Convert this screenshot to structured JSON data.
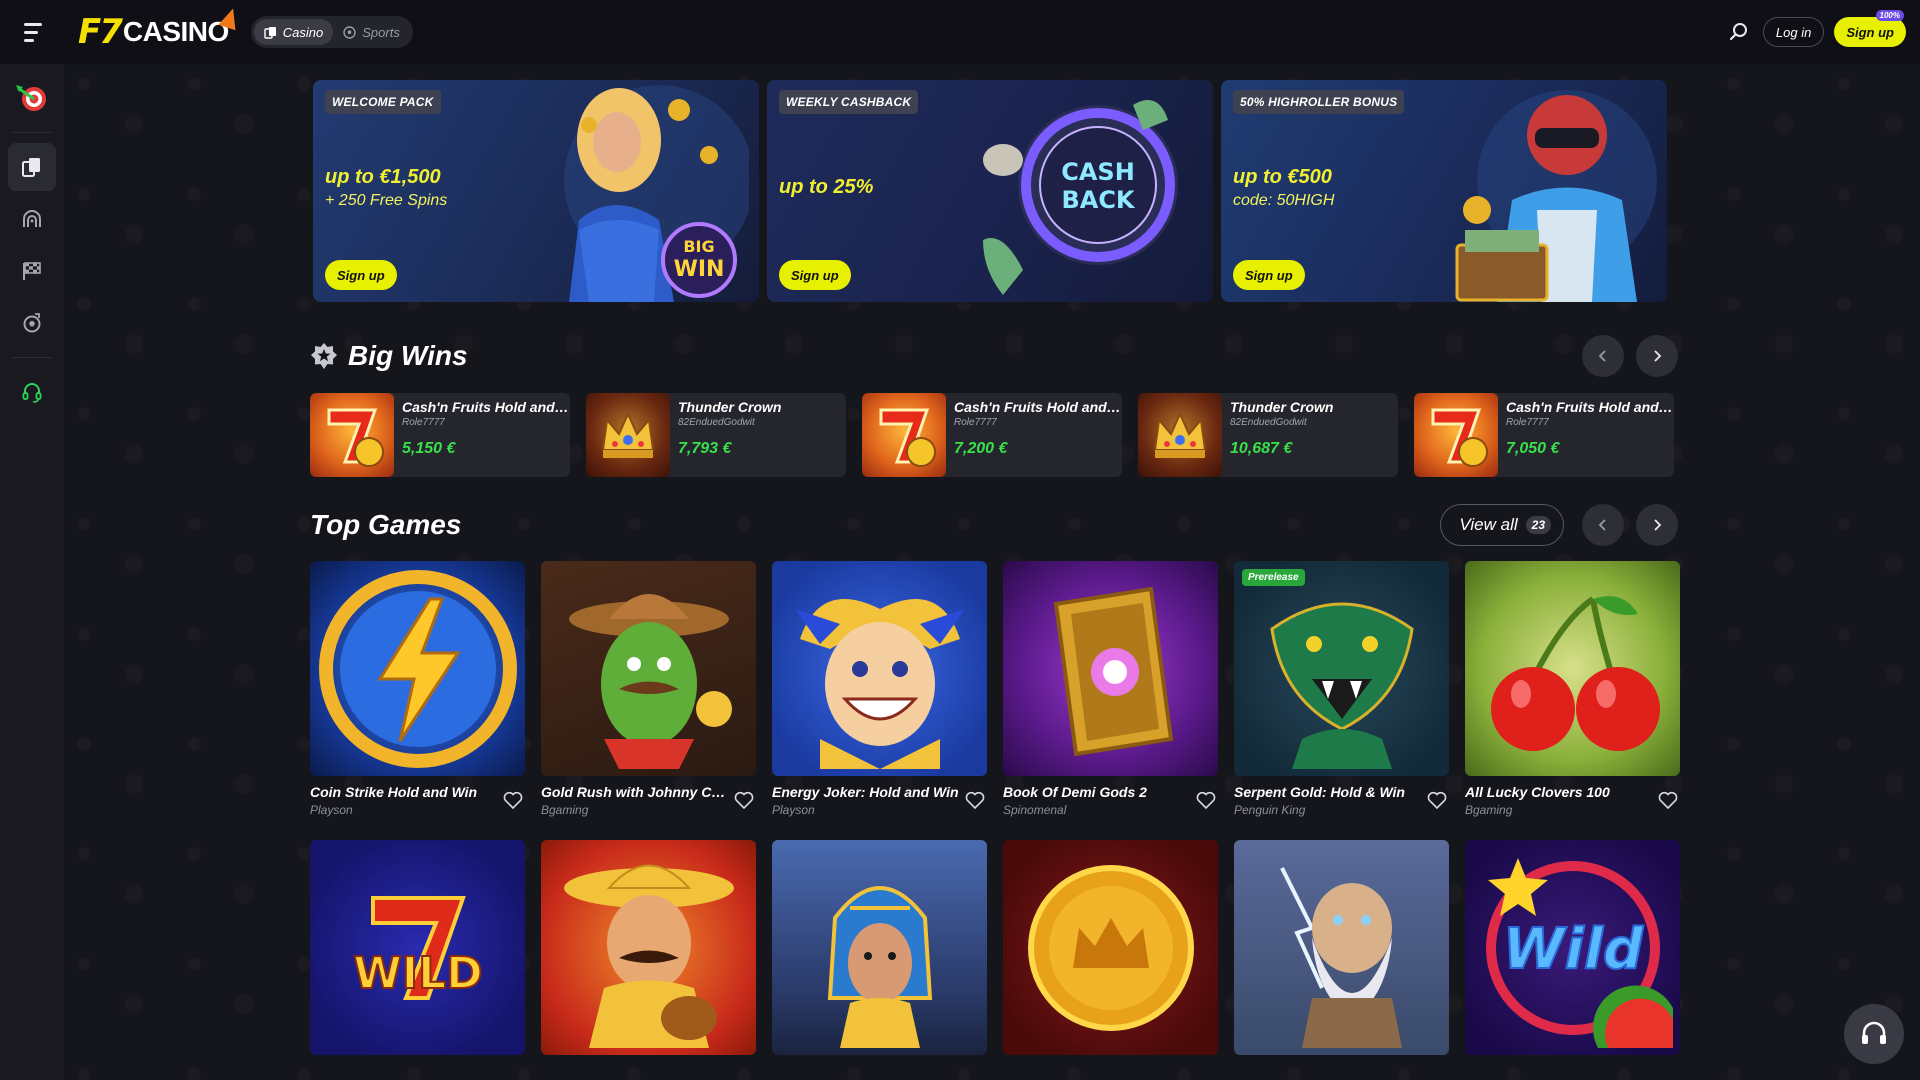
{
  "header": {
    "logo_f7": "F7",
    "logo_casino": "CASINO",
    "tabs": [
      {
        "label": "Casino",
        "icon": "cards-icon",
        "active": true
      },
      {
        "label": "Sports",
        "icon": "soccer-ball-icon",
        "active": false
      }
    ],
    "login_label": "Log in",
    "signup_label": "Sign up",
    "signup_badge": "100%"
  },
  "sidebar": {
    "items": [
      {
        "name": "darts-target-icon"
      },
      {
        "name": "cards-icon",
        "active": true
      },
      {
        "name": "live-casino-icon"
      },
      {
        "name": "racing-flag-icon"
      },
      {
        "name": "sports-icon"
      },
      {
        "name": "support-headset-icon"
      }
    ]
  },
  "promos": [
    {
      "tag": "WELCOME PACK",
      "title": "up to €1,500",
      "sub": "+ 250 Free Spins",
      "button": "Sign up"
    },
    {
      "tag": "WEEKLY CASHBACK",
      "title": "up to 25%",
      "sub": "",
      "button": "Sign up"
    },
    {
      "tag": "50% HIGHROLLER BONUS",
      "title": "up to €500",
      "sub": "code: 50HIGH",
      "button": "Sign up"
    }
  ],
  "promo_art_text": {
    "cash": "CASH",
    "back": "BACK",
    "big": "BIG",
    "win": "WIN"
  },
  "big_wins": {
    "title": "Big Wins",
    "items": [
      {
        "game": "Cash'n Fruits Hold and ...",
        "user": "Role7777",
        "amount": "5,150 €",
        "thumb": "seven"
      },
      {
        "game": "Thunder Crown",
        "user": "82EnduedGodwit",
        "amount": "7,793 €",
        "thumb": "crown"
      },
      {
        "game": "Cash'n Fruits Hold and ...",
        "user": "Role7777",
        "amount": "7,200 €",
        "thumb": "seven"
      },
      {
        "game": "Thunder Crown",
        "user": "82EnduedGodwit",
        "amount": "10,687 €",
        "thumb": "crown"
      },
      {
        "game": "Cash'n Fruits Hold and ...",
        "user": "Role7777",
        "amount": "7,050 €",
        "thumb": "seven"
      }
    ]
  },
  "top_games": {
    "title": "Top Games",
    "view_all_label": "View all",
    "view_all_count": "23",
    "row1": [
      {
        "name": "Coin Strike Hold and Win",
        "provider": "Playson"
      },
      {
        "name": "Gold Rush with Johnny Cash",
        "provider": "Bgaming"
      },
      {
        "name": "Energy Joker: Hold and Win",
        "provider": "Playson"
      },
      {
        "name": "Book Of Demi Gods 2",
        "provider": "Spinomenal"
      },
      {
        "name": "Serpent Gold: Hold & Win",
        "provider": "Penguin King",
        "badge": "Prerelease"
      },
      {
        "name": "All Lucky Clovers 100",
        "provider": "Bgaming"
      }
    ],
    "row2_thumb_text": {
      "wild1": "WILD",
      "wild2": "Wild"
    }
  },
  "colors": {
    "accent": "#e6f000",
    "win_green": "#38e04a",
    "bg": "#121218"
  }
}
